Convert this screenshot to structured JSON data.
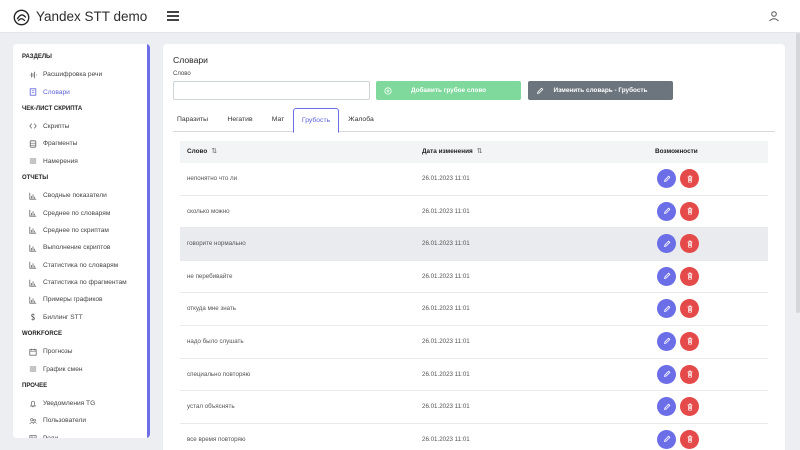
{
  "header": {
    "title": "Yandex STT demo"
  },
  "sidebar": {
    "sections": [
      {
        "title": "РАЗДЕЛЫ",
        "items": [
          {
            "label": "Расшифровка речи",
            "icon": "waveform-icon",
            "active": false
          },
          {
            "label": "Словари",
            "icon": "book-icon",
            "active": true
          }
        ]
      },
      {
        "title": "ЧЕК-ЛИСТ СКРИПТА",
        "items": [
          {
            "label": "Скрипты",
            "icon": "code-icon",
            "active": false
          },
          {
            "label": "Фрагменты",
            "icon": "database-icon",
            "active": false
          },
          {
            "label": "Намерения",
            "icon": "list-icon",
            "active": false
          }
        ]
      },
      {
        "title": "ОТЧЕТЫ",
        "items": [
          {
            "label": "Сводные показатели",
            "icon": "bar-chart-icon",
            "active": false
          },
          {
            "label": "Среднее по словарям",
            "icon": "bar-chart-icon",
            "active": false
          },
          {
            "label": "Среднее по скриптам",
            "icon": "bar-chart-icon",
            "active": false
          },
          {
            "label": "Выполнение скриптов",
            "icon": "bar-chart-icon",
            "active": false
          },
          {
            "label": "Статистика по словарям",
            "icon": "bar-chart-icon",
            "active": false
          },
          {
            "label": "Статистика по фрагментам",
            "icon": "bar-chart-icon",
            "active": false
          },
          {
            "label": "Примеры графиков",
            "icon": "bar-chart-icon",
            "active": false
          },
          {
            "label": "Биллинг STT",
            "icon": "dollar-icon",
            "active": false
          }
        ]
      },
      {
        "title": "WORKFORCE",
        "items": [
          {
            "label": "Прогнозы",
            "icon": "calendar-icon",
            "active": false
          },
          {
            "label": "График смен",
            "icon": "list-icon",
            "active": false
          }
        ]
      },
      {
        "title": "ПРОЧЕЕ",
        "items": [
          {
            "label": "Уведомления TG",
            "icon": "bell-icon",
            "active": false
          },
          {
            "label": "Пользователи",
            "icon": "users-icon",
            "active": false
          },
          {
            "label": "Роли",
            "icon": "id-card-icon",
            "active": false
          }
        ]
      }
    ]
  },
  "main": {
    "title": "Словари",
    "word_field": {
      "label": "Слово",
      "value": "",
      "placeholder": ""
    },
    "add_button": "Добавить грубое слово",
    "edit_button": "Изменить словарь - Грубость",
    "tabs": [
      {
        "label": "Паразиты",
        "active": false
      },
      {
        "label": "Негатив",
        "active": false
      },
      {
        "label": "Мат",
        "active": false
      },
      {
        "label": "Грубость",
        "active": true
      },
      {
        "label": "Жалоба",
        "active": false
      }
    ],
    "table": {
      "columns": [
        "Слово",
        "Дата изменения",
        "Возможности"
      ],
      "rows": [
        {
          "word": "непонятно что ли",
          "date": "26.01.2023 11:01",
          "highlighted": false
        },
        {
          "word": "сколько можно",
          "date": "26.01.2023 11:01",
          "highlighted": false
        },
        {
          "word": "говорите нормально",
          "date": "26.01.2023 11:01",
          "highlighted": true
        },
        {
          "word": "не перебивайте",
          "date": "26.01.2023 11:01",
          "highlighted": false
        },
        {
          "word": "откуда мне знать",
          "date": "26.01.2023 11:01",
          "highlighted": false
        },
        {
          "word": "надо было слушать",
          "date": "26.01.2023 11:01",
          "highlighted": false
        },
        {
          "word": "специально повторяю",
          "date": "26.01.2023 11:01",
          "highlighted": false
        },
        {
          "word": "устал объяснять",
          "date": "26.01.2023 11:01",
          "highlighted": false
        },
        {
          "word": "все время повторяю",
          "date": "26.01.2023 11:01",
          "highlighted": false
        }
      ]
    }
  },
  "colors": {
    "accent": "#6b6ee6",
    "success": "#7fd99c",
    "secondary": "#6c757d",
    "danger": "#e54a4a"
  }
}
